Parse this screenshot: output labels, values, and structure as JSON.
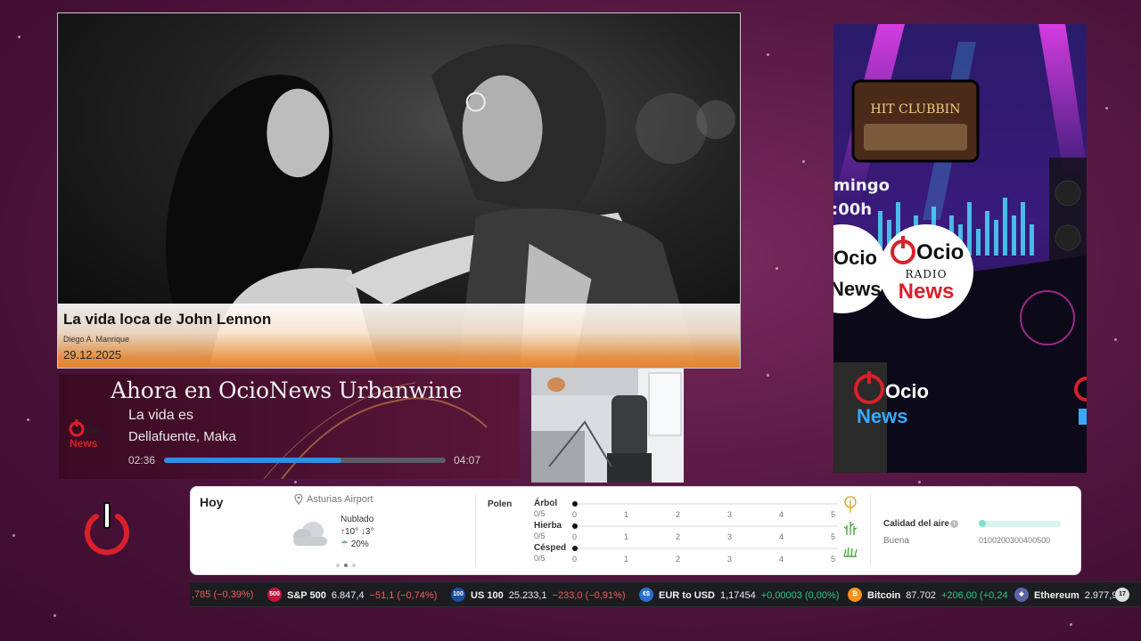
{
  "news": {
    "title": "La vida loca de John Lennon",
    "author": "Diego A. Manrique",
    "date": "29.12.2025"
  },
  "now_playing": {
    "heading": "Ahora en OcioNews Urbanwine",
    "logo_text": "OcioNews",
    "song": "La vida es",
    "artist": "Dellafuente, Maka",
    "elapsed": "02:36",
    "total": "04:07",
    "progress": 0.63
  },
  "promo": {
    "sign": "HIT CLUBBIN",
    "day_partial": "mingo",
    "time_partial": ":00h",
    "logo_ocio": "Ocio",
    "logo_radio": "RADIO",
    "logo_news": "News",
    "left_ocio": "Ocio",
    "left_news": "News",
    "bottom_ocio": "Ocio",
    "bottom_news": "News"
  },
  "weather": {
    "today": "Hoy",
    "location": "Asturias Airport",
    "condition": "Nublado",
    "high": "10°",
    "low": "3°",
    "rain": "20%",
    "pollen": {
      "title": "Polen",
      "rows": [
        {
          "name": "Árbol",
          "value": "0/5",
          "level": 0
        },
        {
          "name": "Hierba",
          "value": "0/5",
          "level": 0
        },
        {
          "name": "Césped",
          "value": "0/5",
          "level": 0
        }
      ],
      "scale": [
        "0",
        "1",
        "2",
        "3",
        "4",
        "5"
      ]
    },
    "air_quality": {
      "title": "Calidad del aire",
      "label": "Buena",
      "scale": "0100200300400500",
      "level": 0
    }
  },
  "ticker": [
    {
      "name": "",
      "price": "",
      "change": ",785 (−0,39%)",
      "dir": "neg"
    },
    {
      "icon": "500",
      "icon_color": "#c0143c",
      "name": "S&P 500",
      "price": "6.847,4",
      "change": "−51,1 (−0,74%)",
      "dir": "neg"
    },
    {
      "icon": "100",
      "icon_color": "#1b4f9c",
      "name": "US 100",
      "price": "25.233,1",
      "change": "−233,0 (−0,91%)",
      "dir": "neg"
    },
    {
      "icon": "€$",
      "icon_color": "#2a6fcf",
      "name": "EUR to USD",
      "price": "1,17454",
      "change": "+0,00003 (0,00%)",
      "dir": "pos"
    },
    {
      "icon": "₿",
      "icon_color": "#f7931a",
      "name": "Bitcoin",
      "price": "87.702",
      "change": "+206,00 (+0,24",
      "dir": "pos"
    },
    {
      "icon": "◆",
      "icon_color": "#5b63a8",
      "name": "Ethereum",
      "price": "2.977,9",
      "change": "",
      "dir": "pos"
    }
  ],
  "colors": {
    "accent_orange": "#e8822b",
    "progress_blue": "#2f8fe0",
    "power_red": "#d9202a",
    "neg": "#f25b5b",
    "pos": "#2fc48a"
  }
}
